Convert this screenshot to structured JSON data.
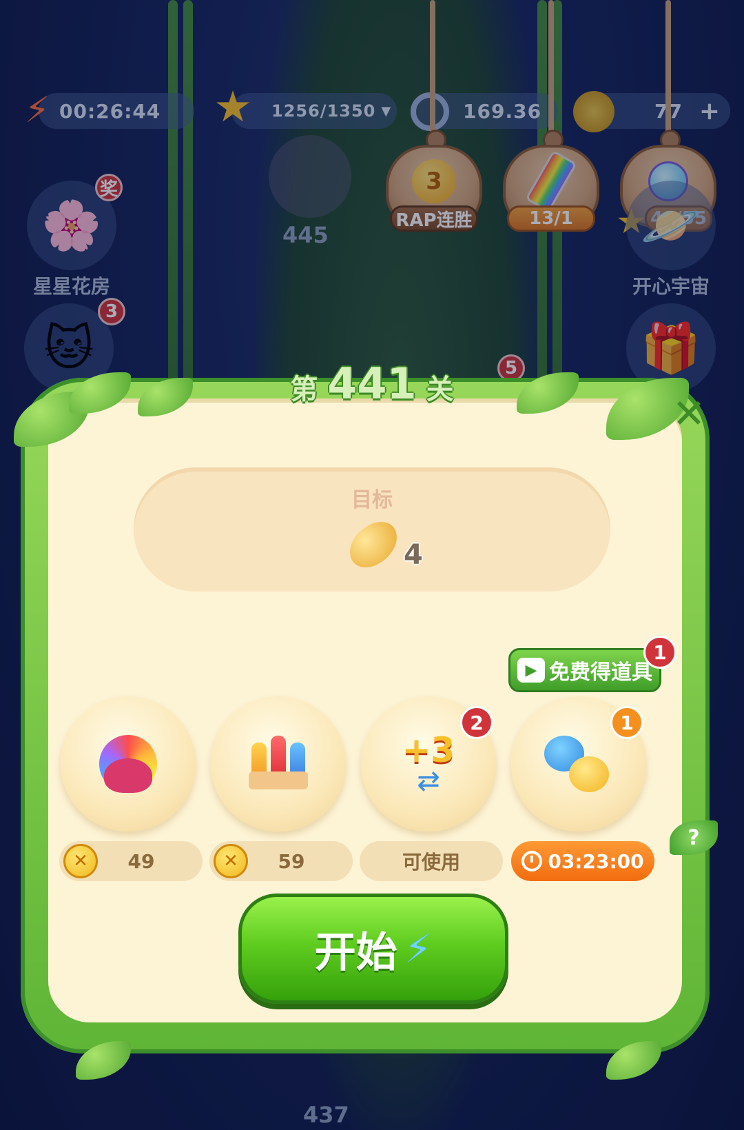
{
  "topbar": {
    "energy_timer": "00:26:44",
    "stars": "1256/1350",
    "points": "169.36",
    "coins": "77"
  },
  "hanging_rewards": [
    {
      "icon": "lightbulb-icon",
      "badge": "3",
      "label": "RAP连胜"
    },
    {
      "icon": "rainbow-tube-icon",
      "label": "13/1"
    },
    {
      "icon": "potion-icon",
      "label": "48/55"
    }
  ],
  "left_features": [
    {
      "name": "星星花房",
      "badge": "奖"
    },
    {
      "name": "",
      "badge": "3"
    }
  ],
  "right_features": [
    {
      "name": "开心宇宙"
    }
  ],
  "map": {
    "node_top": "445",
    "node_bottom": "437",
    "node_mid_badge": "5"
  },
  "level": {
    "prefix": "第",
    "number": "441",
    "suffix": "关"
  },
  "goal": {
    "label": "目标",
    "item": "bean-icon",
    "count": "4"
  },
  "free_props": {
    "label": "免费得道具",
    "badge": "1"
  },
  "boosters": [
    {
      "icon": "rainbow-owl-icon",
      "price": "49"
    },
    {
      "icon": "firework-rockets-icon",
      "price": "59"
    },
    {
      "icon": "plus3-swap-icon",
      "badge": "2",
      "status": "可使用"
    },
    {
      "icon": "hippo-chick-icon",
      "badge": "1",
      "timer": "03:23:00"
    }
  ],
  "help": "?",
  "start_button": "开始",
  "colors": {
    "dialog_green": "#5fb536",
    "panel_cream": "#fdf4d6",
    "start_green": "#5fcd1f",
    "timer_orange": "#f26c0f"
  }
}
